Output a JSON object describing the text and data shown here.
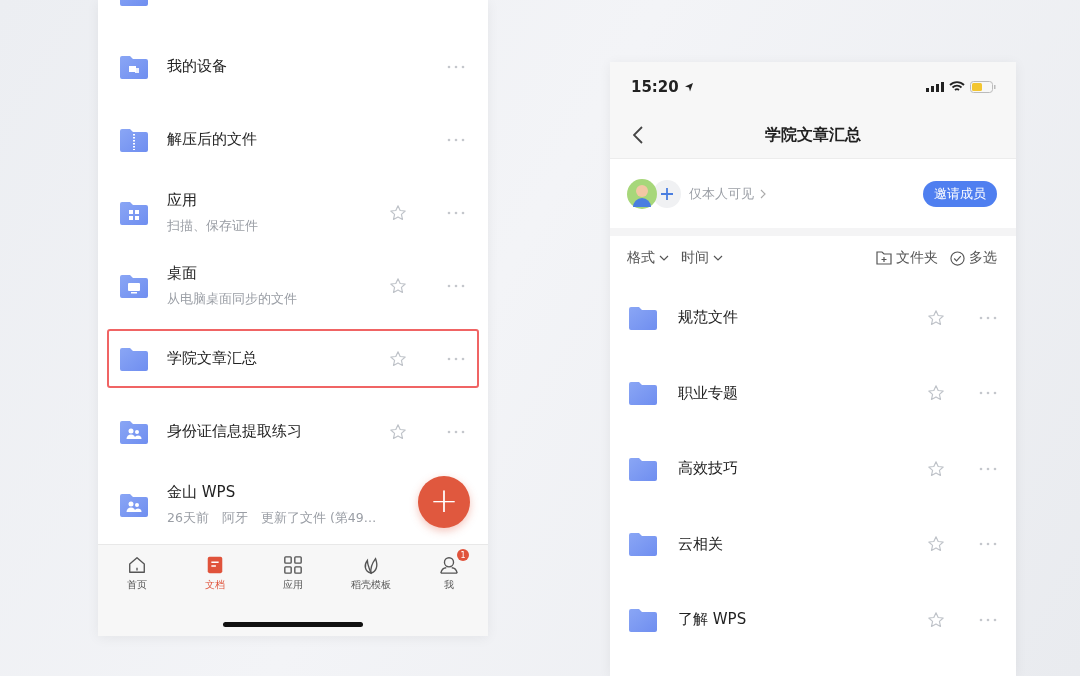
{
  "docs_screen": {
    "files": [
      {
        "kind": "device",
        "name": "我的设备",
        "star": false,
        "highlighted": false
      },
      {
        "kind": "zip",
        "name": "解压后的文件",
        "star": false,
        "highlighted": false
      },
      {
        "kind": "apps",
        "name": "应用",
        "subtitle": "扫描、保存证件",
        "star": true,
        "highlighted": false
      },
      {
        "kind": "desktop",
        "name": "桌面",
        "subtitle": "从电脑桌面同步的文件",
        "star": true,
        "highlighted": false
      },
      {
        "kind": "plain",
        "name": "学院文章汇总",
        "star": true,
        "highlighted": true
      },
      {
        "kind": "shared",
        "name": "身份证信息提取练习",
        "star": true,
        "highlighted": false
      },
      {
        "kind": "shared",
        "name": "金山 WPS",
        "subtitle": "26天前　阿牙　更新了文件 (第49…",
        "star": false,
        "highlighted": false
      }
    ],
    "fab": "+",
    "tabs": [
      {
        "kind": "home",
        "label": "首页",
        "selected": false
      },
      {
        "kind": "doc",
        "label": "文档",
        "selected": true
      },
      {
        "kind": "grid",
        "label": "应用",
        "selected": false
      },
      {
        "kind": "leaf",
        "label": "稻壳模板",
        "selected": false
      },
      {
        "kind": "user",
        "label": "我",
        "selected": false,
        "badge": "1"
      }
    ]
  },
  "folder_screen": {
    "status_bar": {
      "time": "15:20"
    },
    "title": "学院文章汇总",
    "visibility": "仅本人可见",
    "invite_button": "邀请成员",
    "toolbar": {
      "sorts": [
        "格式",
        "时间"
      ],
      "new_folder": "文件夹",
      "multi_select": "多选"
    },
    "files": [
      {
        "name": "规范文件",
        "star": true
      },
      {
        "name": "职业专题",
        "star": true
      },
      {
        "name": "高效技巧",
        "star": true
      },
      {
        "name": "云相关",
        "star": true
      },
      {
        "name": "了解 WPS",
        "star": true
      }
    ]
  }
}
